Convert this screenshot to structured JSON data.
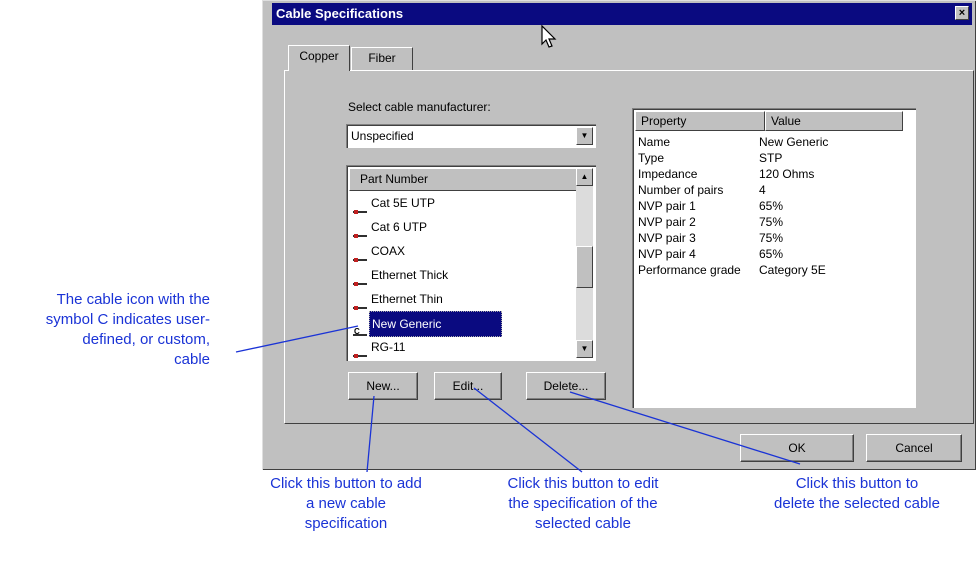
{
  "dialog": {
    "title": "Cable Specifications",
    "close_glyph": "×",
    "tabs": [
      "Copper",
      "Fiber"
    ],
    "manufacturer_label": "Select cable manufacturer:",
    "manufacturer_value": "Unspecified",
    "list_header": "Part Number",
    "list_items": [
      {
        "label": "Cat 5E UTP",
        "custom": false,
        "selected": false
      },
      {
        "label": "Cat 6 UTP",
        "custom": false,
        "selected": false
      },
      {
        "label": "COAX",
        "custom": false,
        "selected": false
      },
      {
        "label": "Ethernet Thick",
        "custom": false,
        "selected": false
      },
      {
        "label": "Ethernet Thin",
        "custom": false,
        "selected": false
      },
      {
        "label": "New Generic",
        "custom": true,
        "selected": true
      },
      {
        "label": "RG-11",
        "custom": false,
        "selected": false
      }
    ],
    "buttons": {
      "new": "New...",
      "edit": "Edit...",
      "delete": "Delete...",
      "ok": "OK",
      "cancel": "Cancel"
    },
    "properties": {
      "headers": [
        "Property",
        "Value"
      ],
      "rows": [
        [
          "Name",
          "New Generic"
        ],
        [
          "Type",
          "STP"
        ],
        [
          "Impedance",
          "120 Ohms"
        ],
        [
          "Number of pairs",
          "4"
        ],
        [
          "NVP pair 1",
          "65%"
        ],
        [
          "NVP pair 2",
          "75%"
        ],
        [
          "NVP pair 3",
          "75%"
        ],
        [
          "NVP pair 4",
          "65%"
        ],
        [
          "Performance grade",
          "Category 5E"
        ]
      ]
    }
  },
  "callouts": {
    "custom_icon": [
      "The cable icon with the",
      "symbol C indicates user-",
      "defined, or custom,",
      "cable"
    ],
    "new": [
      "Click this button to add",
      "a new cable",
      "specification"
    ],
    "edit": [
      "Click this button to edit",
      "the specification of the",
      "selected cable"
    ],
    "delete": [
      "Click this button to",
      "delete the selected cable"
    ]
  },
  "icons": {
    "cable": "cable-icon",
    "custom_cable": "custom-cable-icon",
    "close": "close-icon",
    "dropdown": "chevron-down-icon",
    "scroll_up": "scroll-up-icon",
    "scroll_down": "scroll-down-icon",
    "cursor": "mouse-pointer-icon"
  },
  "colors": {
    "titlebar": "#0a0a80",
    "selection": "#0a0a80",
    "callout_text": "#1a33d6",
    "dialog_face": "#c0c0c0"
  }
}
